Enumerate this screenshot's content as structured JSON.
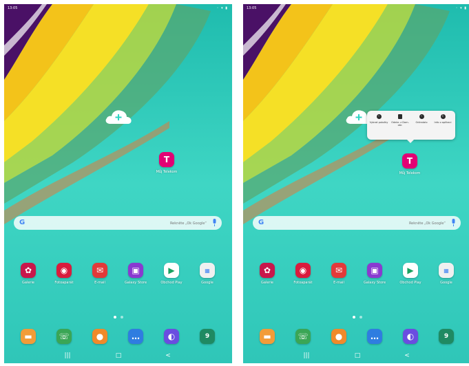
{
  "status_bar": {
    "time": "13:05",
    "icons": "◦ ▾ ▮"
  },
  "search": {
    "placeholder": "Řekněte „Ok Google“"
  },
  "home_app": {
    "label": "Můj Telekom",
    "glyph": "T"
  },
  "popup": {
    "items": [
      {
        "label": "Vybrat položky",
        "icon": "select-icon"
      },
      {
        "label": "Odebr. z Dom. obr.",
        "icon": "trash-icon"
      },
      {
        "label": "Odinstalo",
        "icon": "uninstall-icon"
      },
      {
        "label": "Info o aplikaci",
        "icon": "info-icon"
      }
    ]
  },
  "apps_row": [
    {
      "label": "Galerie",
      "color": "#c8174b",
      "icon": "gallery-icon"
    },
    {
      "label": "Fotoaparát",
      "color": "#d91c3d",
      "icon": "camera-icon"
    },
    {
      "label": "E-mail",
      "color": "#e23a3a",
      "icon": "email-icon"
    },
    {
      "label": "Galaxy Store",
      "color": "#8a3ad0",
      "icon": "store-icon"
    },
    {
      "label": "Obchod Play",
      "color": "#ffffff",
      "icon": "play-store-icon"
    },
    {
      "label": "Google",
      "color": "#f0f0f0",
      "icon": "google-folder-icon"
    }
  ],
  "dock": [
    {
      "color": "#f29c38",
      "icon": "my-files-icon"
    },
    {
      "color": "#3aa655",
      "icon": "phone-icon"
    },
    {
      "color": "#f08a2a",
      "icon": "contacts-icon"
    },
    {
      "color": "#2f7de0",
      "icon": "messages-icon"
    },
    {
      "color": "#6a4de0",
      "icon": "internet-icon"
    },
    {
      "color": "#1f8a62",
      "icon": "calendar-icon",
      "text": "9"
    }
  ],
  "nav": {
    "recent": "|||",
    "home": "□",
    "back": "<"
  }
}
